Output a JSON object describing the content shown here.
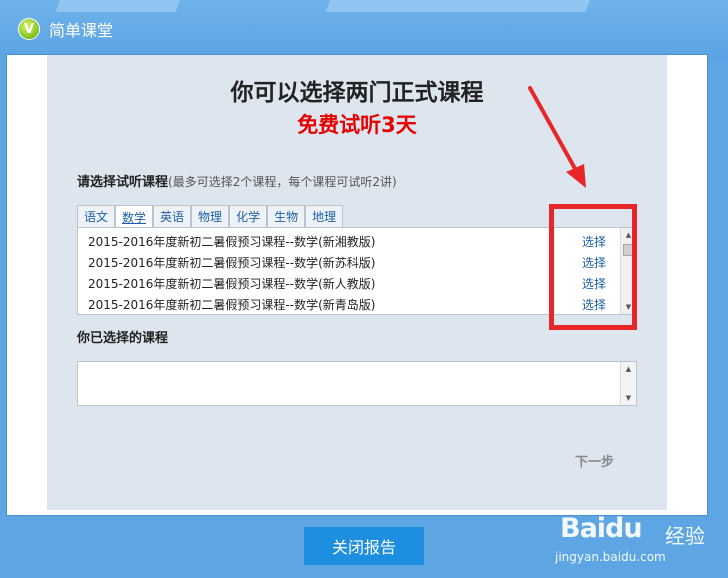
{
  "app": {
    "title": "简单课堂",
    "logo_letter": "V"
  },
  "dialog": {
    "headline": "你可以选择两门正式课程",
    "subline": "免费试听3天",
    "instruction": "请选择试听课程",
    "instruction_note": "(最多可选择2个课程，每个课程可试听2讲)",
    "tabs": [
      {
        "label": "语文",
        "active": false
      },
      {
        "label": "数学",
        "active": true
      },
      {
        "label": "英语",
        "active": false
      },
      {
        "label": "物理",
        "active": false
      },
      {
        "label": "化学",
        "active": false
      },
      {
        "label": "生物",
        "active": false
      },
      {
        "label": "地理",
        "active": false
      }
    ],
    "courses": [
      {
        "name": "2015-2016年度新初二暑假预习课程--数学(新湘教版)",
        "action": "选择"
      },
      {
        "name": "2015-2016年度新初二暑假预习课程--数学(新苏科版)",
        "action": "选择"
      },
      {
        "name": "2015-2016年度新初二暑假预习课程--数学(新人教版)",
        "action": "选择"
      },
      {
        "name": "2015-2016年度新初二暑假预习课程--数学(新青岛版)",
        "action": "选择"
      }
    ],
    "chosen_label": "你已选择的课程",
    "next_label": "下一步"
  },
  "footer": {
    "close_label": "关闭报告"
  },
  "watermark": {
    "brand": "Baidu",
    "sub": "经验",
    "url": "jingyan.baidu.com"
  },
  "colors": {
    "accent": "#1e8fe0",
    "highlight": "#e60000",
    "annotation": "#e8262a",
    "link": "#1c5fa8"
  }
}
